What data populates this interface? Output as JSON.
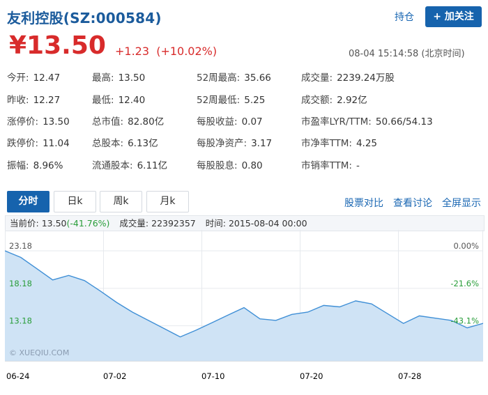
{
  "header": {
    "title": "友利控股(SZ:000584)",
    "hold_label": "持仓",
    "follow_label": "+ 加关注"
  },
  "price": {
    "current": "¥13.50",
    "change": "+1.23",
    "change_pct": "(+10.02%)",
    "timestamp": "08-04 15:14:58 (北京时间)"
  },
  "quotes": [
    [
      {
        "k": "今开:",
        "v": "12.47"
      },
      {
        "k": "最高:",
        "v": "13.50"
      },
      {
        "k": "52周最高:",
        "v": "35.66"
      },
      {
        "k": "成交量:",
        "v": "2239.24万股"
      }
    ],
    [
      {
        "k": "昨收:",
        "v": "12.27"
      },
      {
        "k": "最低:",
        "v": "12.40"
      },
      {
        "k": "52周最低:",
        "v": "5.25"
      },
      {
        "k": "成交额:",
        "v": "2.92亿"
      }
    ],
    [
      {
        "k": "涨停价:",
        "v": "13.50"
      },
      {
        "k": "总市值:",
        "v": "82.80亿"
      },
      {
        "k": "每股收益:",
        "v": "0.07"
      },
      {
        "k": "市盈率LYR/TTM:",
        "v": "50.66/54.13"
      }
    ],
    [
      {
        "k": "跌停价:",
        "v": "11.04"
      },
      {
        "k": "总股本:",
        "v": "6.13亿"
      },
      {
        "k": "每股净资产:",
        "v": "3.17"
      },
      {
        "k": "市净率TTM:",
        "v": "4.25"
      }
    ],
    [
      {
        "k": "振幅:",
        "v": "8.96%"
      },
      {
        "k": "流通股本:",
        "v": "6.11亿"
      },
      {
        "k": "每股股息:",
        "v": "0.80"
      },
      {
        "k": "市销率TTM:",
        "v": "-"
      }
    ]
  ],
  "tabs": [
    "分时",
    "日k",
    "周k",
    "月k"
  ],
  "links": [
    "股票对比",
    "查看讨论",
    "全屏显示"
  ],
  "infobar": {
    "price_label": "当前价:",
    "price_value": "13.50",
    "price_pct": "(-41.76%)",
    "volume_label": "成交量:",
    "volume_value": "22392357",
    "time_label": "时间:",
    "time_value": "2015-08-04 00:00"
  },
  "colors": {
    "up": "#d82b2b",
    "down": "#2a9d3a",
    "accent": "#1663ad",
    "line": "#3f8fd6",
    "fill": "#cfe3f5"
  },
  "chart_data": {
    "type": "area",
    "watermark": "© XUEQIU.COM",
    "y_left_ticks": [
      23.18,
      18.18,
      13.18
    ],
    "y_right_ticks": [
      "0.00%",
      "-21.6%",
      "-43.1%"
    ],
    "ylim": [
      8.5,
      23.18
    ],
    "x_ticks": [
      "06-24",
      "07-02",
      "07-10",
      "07-20",
      "07-28"
    ],
    "x": [
      "06-24",
      "06-25",
      "06-26",
      "06-29",
      "06-30",
      "07-01",
      "07-02",
      "07-03",
      "07-06",
      "07-07",
      "07-08",
      "07-09",
      "07-10",
      "07-13",
      "07-14",
      "07-15",
      "07-16",
      "07-17",
      "07-20",
      "07-21",
      "07-22",
      "07-23",
      "07-24",
      "07-27",
      "07-28",
      "07-29",
      "07-30",
      "07-31",
      "08-03",
      "08-04"
    ],
    "values": [
      23.18,
      22.3,
      20.8,
      19.3,
      19.9,
      19.2,
      17.8,
      16.3,
      15.0,
      13.9,
      12.8,
      11.7,
      12.6,
      13.6,
      14.6,
      15.6,
      14.1,
      13.9,
      14.7,
      15.0,
      15.9,
      15.7,
      16.5,
      16.1,
      14.8,
      13.5,
      14.5,
      14.2,
      13.9,
      12.9,
      13.5
    ]
  }
}
